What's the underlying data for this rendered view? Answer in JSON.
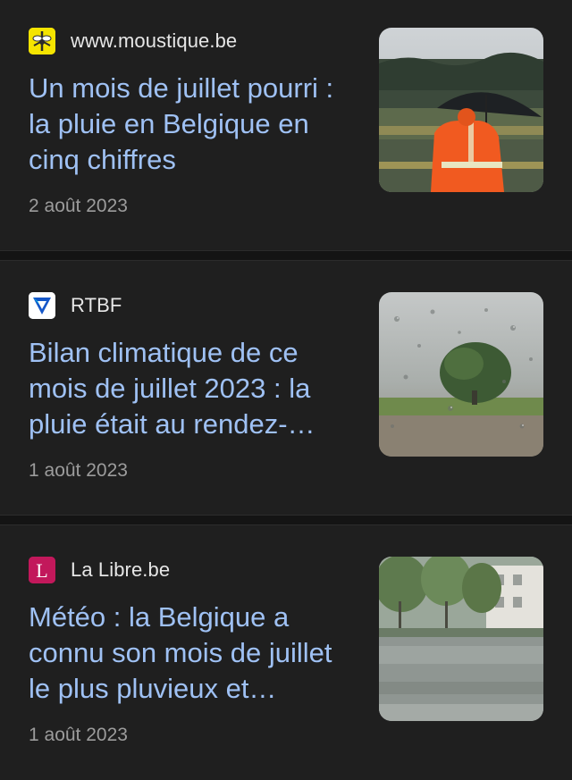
{
  "articles": [
    {
      "source": "www.moustique.be",
      "favicon_icon": "mosquito-icon",
      "favicon_color": "#f5e400",
      "headline": "Un mois de juillet pourri : la pluie en Belgique en cinq chiffres",
      "date": "2 août 2023",
      "thumbnail": "person-umbrella-rain-image"
    },
    {
      "source": "RTBF",
      "favicon_icon": "rtbf-play-icon",
      "favicon_color": "#ffffff",
      "headline": "Bilan climatique de ce mois de juillet 2023 : la pluie était au rendez-…",
      "date": "1 août 2023",
      "thumbnail": "tree-rainy-window-image"
    },
    {
      "source": "La Libre.be",
      "favicon_icon": "la-libre-logo-icon",
      "favicon_color": "#c2185b",
      "headline": "Météo : la Belgique a connu son mois de juillet le plus pluvieux et…",
      "date": "1 août 2023",
      "thumbnail": "flooded-street-image"
    }
  ]
}
